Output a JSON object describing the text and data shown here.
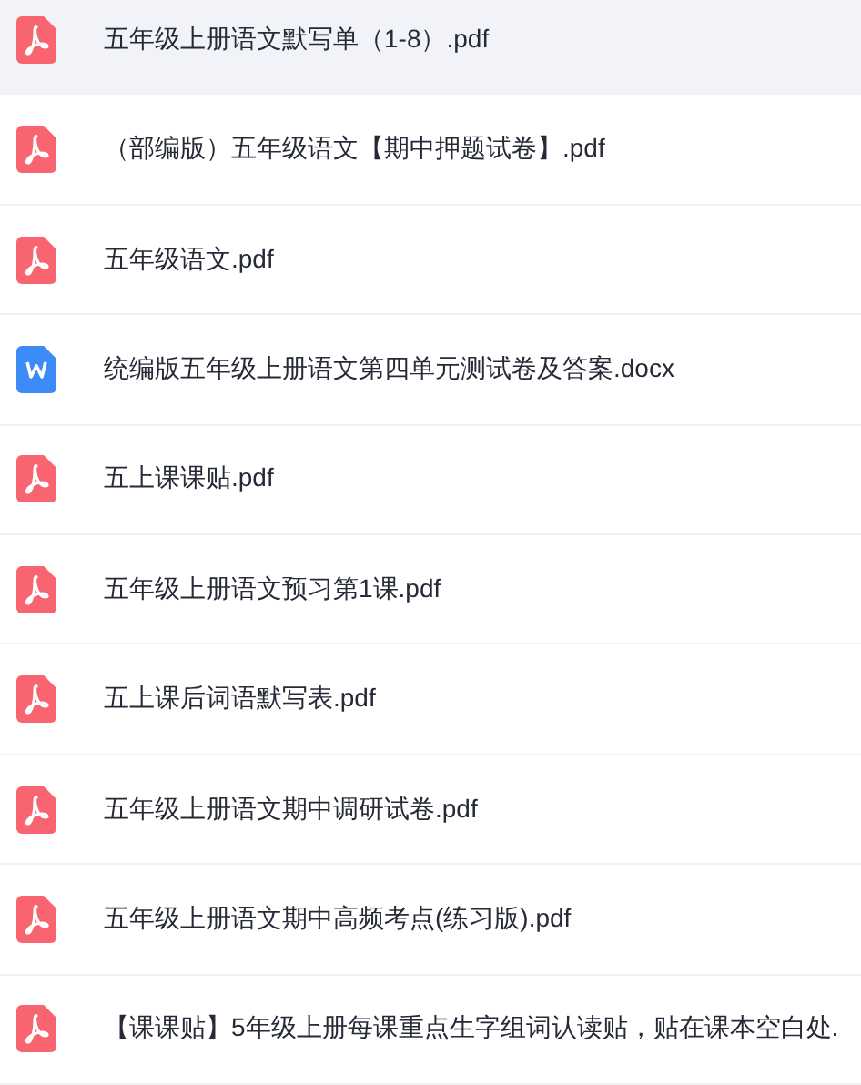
{
  "files": [
    {
      "kind": "pdf",
      "name": "五年级上册语文默写单（1-8）.pdf",
      "selected": true
    },
    {
      "kind": "pdf",
      "name": "（部编版）五年级语文【期中押题试卷】.pdf",
      "selected": false
    },
    {
      "kind": "pdf",
      "name": "五年级语文.pdf",
      "selected": false
    },
    {
      "kind": "word",
      "name": "统编版五年级上册语文第四单元测试卷及答案.docx",
      "selected": false
    },
    {
      "kind": "pdf",
      "name": "五上课课贴.pdf",
      "selected": false
    },
    {
      "kind": "pdf",
      "name": "五年级上册语文预习第1课.pdf",
      "selected": false
    },
    {
      "kind": "pdf",
      "name": "五上课后词语默写表.pdf",
      "selected": false
    },
    {
      "kind": "pdf",
      "name": "五年级上册语文期中调研试卷.pdf",
      "selected": false
    },
    {
      "kind": "pdf",
      "name": "五年级上册语文期中高频考点(练习版).pdf",
      "selected": false
    },
    {
      "kind": "pdf",
      "name": "【课课贴】5年级上册每课重点生字组词认读贴，贴在课本空白处.",
      "selected": false
    }
  ]
}
